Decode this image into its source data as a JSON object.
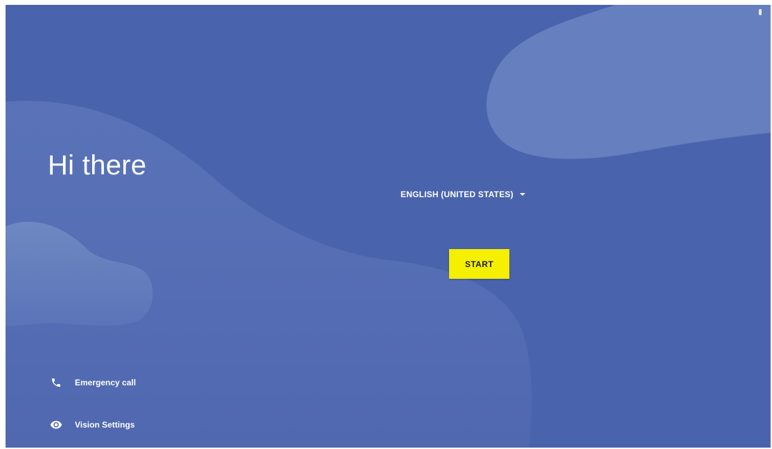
{
  "welcome": {
    "greeting": "Hi there"
  },
  "language": {
    "selected": "ENGLISH (UNITED STATES)",
    "icon": "dropdown-arrow-icon"
  },
  "actions": {
    "start_label": "START"
  },
  "bottom_links": [
    {
      "label": "Emergency call",
      "icon": "phone-icon"
    },
    {
      "label": "Vision Settings",
      "icon": "eye-icon"
    }
  ],
  "colors": {
    "background": "#4a63ad",
    "accent": "#f5ef00",
    "text": "#ffffff"
  }
}
